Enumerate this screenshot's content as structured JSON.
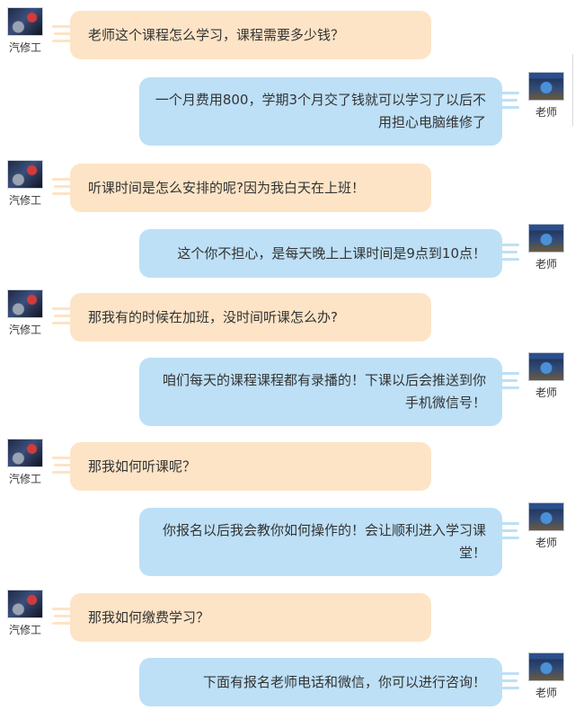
{
  "participants": {
    "student": "汽修工",
    "teacher": "老师"
  },
  "messages": [
    {
      "from": "student",
      "text": "老师这个课程怎么学习，课程需要多少钱？"
    },
    {
      "from": "teacher",
      "text": "一个月费用800，学期3个月交了钱就可以学习了以后不用担心电脑维修了"
    },
    {
      "from": "student",
      "text": "听课时间是怎么安排的呢?因为我白天在上班！"
    },
    {
      "from": "teacher",
      "text": "这个你不担心，是每天晚上上课时间是9点到10点！"
    },
    {
      "from": "student",
      "text": "那我有的时候在加班，没时间听课怎么办?"
    },
    {
      "from": "teacher",
      "text": "咱们每天的课程课程都有录播的！下课以后会推送到你手机微信号！"
    },
    {
      "from": "student",
      "text": "那我如何听课呢？"
    },
    {
      "from": "teacher",
      "text": "你报名以后我会教你如何操作的！会让顺利进入学习课堂！"
    },
    {
      "from": "student",
      "text": "那我如何缴费学习？"
    },
    {
      "from": "teacher",
      "text": "下面有报名老师电话和微信，你可以进行咨询！"
    }
  ],
  "colors": {
    "student_bubble": "#fde4c6",
    "teacher_bubble": "#bde0f7"
  }
}
